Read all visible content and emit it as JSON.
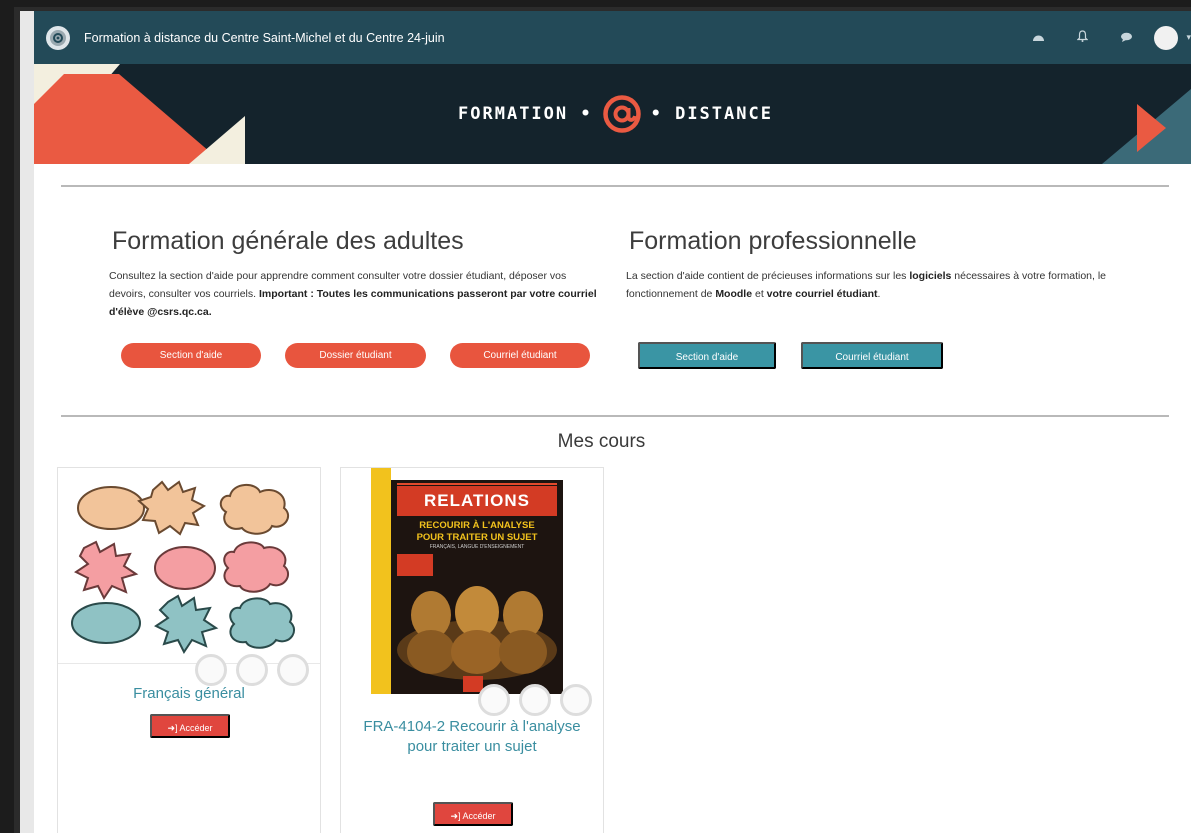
{
  "navbar": {
    "site_title": "Formation à distance du Centre Saint-Michel et du Centre 24-juin",
    "icons": [
      "dashboard-icon",
      "bell-icon",
      "chat-icon",
      "avatar",
      "chevron-down-icon"
    ]
  },
  "banner": {
    "word_left": "FORMATION •",
    "word_right": "• DISTANCE"
  },
  "fga": {
    "heading": "Formation générale des adultes",
    "text_plain": "Consultez la section d'aide pour apprendre comment consulter votre dossier étudiant, déposer vos devoirs, consulter vos courriels. ",
    "text_bold": "Important : Toutes les communications passeront par votre courriel d'élève @csrs.qc.ca.",
    "buttons": [
      "Section d'aide",
      "Dossier étudiant",
      "Courriel étudiant"
    ]
  },
  "fp": {
    "heading": "Formation professionnelle",
    "text_1": "La section d'aide contient de précieuses informations sur les ",
    "text_bold_1": "logiciels",
    "text_2": " nécessaires à votre formation, le fonctionnement de ",
    "text_bold_2": "Moodle",
    "text_3": " et ",
    "text_bold_3": "votre courriel étudiant",
    "text_4": ".",
    "buttons": [
      "Section d'aide",
      "Courriel étudiant"
    ]
  },
  "mes_cours": "Mes cours",
  "courses": [
    {
      "title": "Français général",
      "button": "Accéder"
    },
    {
      "title": "FRA-4104-2 Recourir à l'analyse pour traiter un sujet",
      "button": "Accéder",
      "cover": {
        "brand": "RELATIONS",
        "line1": "RECOURIR À L'ANALYSE",
        "line2": "POUR TRAITER UN SUJET",
        "line3": "FRANÇAIS, LANGUE D'ENSEIGNEMENT"
      }
    }
  ]
}
